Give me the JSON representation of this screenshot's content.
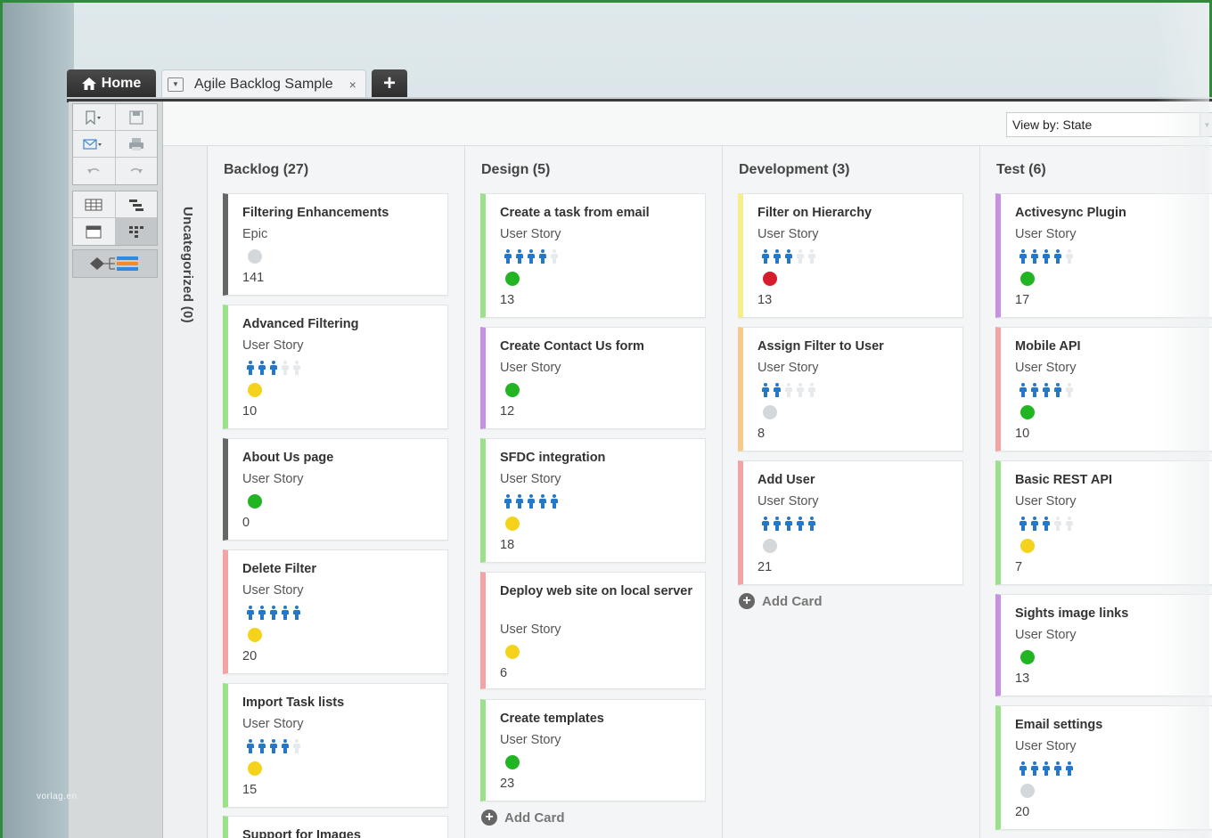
{
  "tabs": {
    "home_label": "Home",
    "doc_label": "Agile Backlog Sample",
    "close_glyph": "×",
    "add_glyph": "+"
  },
  "viewby": {
    "label": "View by: State"
  },
  "uncategorized": {
    "label": "Uncategorized (0)"
  },
  "watermark": "vorlag.en",
  "add_card_label": "Add Card",
  "colors": {
    "gray": "#666666",
    "green": "#9be08a",
    "purple": "#c690e6",
    "yellow": "#f6ee8c",
    "orange": "#f7c98a",
    "pink": "#f3a3a3",
    "status_green": "#22b422",
    "status_yellow": "#f5d21c",
    "status_red": "#d81b2a",
    "status_gray": "#d5d8da"
  },
  "columns": [
    {
      "title": "Backlog (27)",
      "cards": [
        {
          "title": "Filtering Enhancements",
          "type": "Epic",
          "people": 0,
          "status": "gray",
          "color": "gray",
          "num": "141"
        },
        {
          "title": "Advanced Filtering",
          "type": "User Story",
          "people": 3,
          "status": "yellow",
          "color": "green",
          "num": "10"
        },
        {
          "title": "About Us page",
          "type": "User Story",
          "people": 0,
          "status": "green",
          "color": "gray",
          "num": "0"
        },
        {
          "title": "Delete Filter",
          "type": "User Story",
          "people": 5,
          "status": "yellow",
          "color": "pink",
          "num": "20"
        },
        {
          "title": "Import Task lists",
          "type": "User Story",
          "people": 4,
          "status": "yellow",
          "color": "green",
          "num": "15"
        },
        {
          "title": "Support for Images",
          "type": "",
          "people": 0,
          "status": "",
          "color": "green",
          "num": ""
        }
      ]
    },
    {
      "title": "Design (5)",
      "cards": [
        {
          "title": "Create a task from email",
          "type": "User Story",
          "people": 4,
          "status": "green",
          "color": "green",
          "num": "13"
        },
        {
          "title": "Create Contact Us form",
          "type": "User Story",
          "people": 0,
          "status": "green",
          "color": "purple",
          "num": "12"
        },
        {
          "title": "SFDC integration",
          "type": "User Story",
          "people": 5,
          "status": "yellow",
          "color": "green",
          "num": "18"
        },
        {
          "title": "Deploy web site on local server",
          "type": "User Story",
          "people": 0,
          "status": "yellow",
          "color": "pink",
          "num": "6"
        },
        {
          "title": "Create templates",
          "type": "User Story",
          "people": 0,
          "status": "green",
          "color": "green",
          "num": "23"
        }
      ]
    },
    {
      "title": "Development (3)",
      "cards": [
        {
          "title": "Filter on Hierarchy",
          "type": "User Story",
          "people": 3,
          "status": "red",
          "color": "yellow",
          "num": "13"
        },
        {
          "title": "Assign Filter to User",
          "type": "User Story",
          "people": 2,
          "status": "gray",
          "color": "orange",
          "num": "8"
        },
        {
          "title": "Add User",
          "type": "User Story",
          "people": 5,
          "status": "gray",
          "color": "pink",
          "num": "21"
        }
      ]
    },
    {
      "title": "Test (6)",
      "cards": [
        {
          "title": "Activesync Plugin",
          "type": "User Story",
          "people": 4,
          "status": "green",
          "color": "purple",
          "num": "17"
        },
        {
          "title": "Mobile API",
          "type": "User Story",
          "people": 4,
          "status": "green",
          "color": "pink",
          "num": "10"
        },
        {
          "title": "Basic REST API",
          "type": "User Story",
          "people": 3,
          "status": "yellow",
          "color": "green",
          "num": "7"
        },
        {
          "title": "Sights image links",
          "type": "User Story",
          "people": 0,
          "status": "green",
          "color": "purple",
          "num": "13"
        },
        {
          "title": "Email settings",
          "type": "User Story",
          "people": 5,
          "status": "gray",
          "color": "green",
          "num": "20"
        }
      ]
    }
  ]
}
